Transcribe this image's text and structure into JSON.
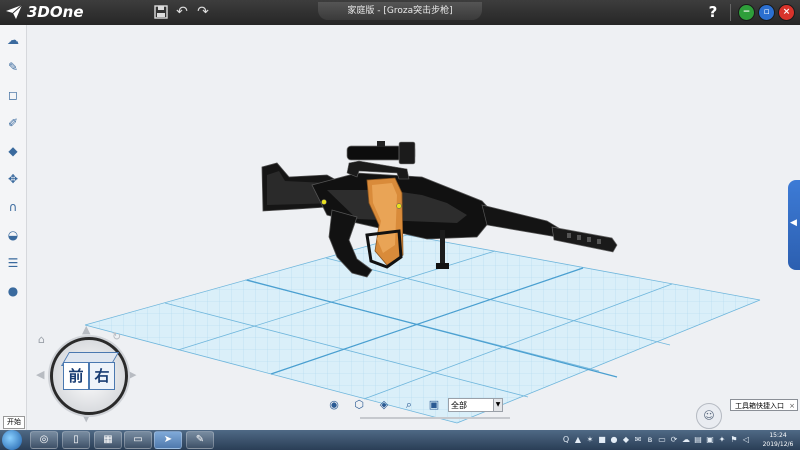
{
  "app": {
    "logo_text": "3DOne",
    "document_title": "家庭版 - [Groza突击步枪]",
    "help_label": "?",
    "colors": {
      "titlebar": "#2f2f2f",
      "accent": "#2c5fb0",
      "grid": "#8fc9e6",
      "model_body": "#111111",
      "model_grip": "#d98b3a"
    }
  },
  "titlebar_icons": [
    "save-icon",
    "undo-icon",
    "redo-icon"
  ],
  "window_controls": [
    {
      "name": "minimize-button",
      "symbol": "−",
      "color": "#2e9e3a"
    },
    {
      "name": "restore-button",
      "symbol": "▫",
      "color": "#2b6fd0"
    },
    {
      "name": "close-button",
      "symbol": "×",
      "color": "#d8332b"
    }
  ],
  "sidebar": {
    "items": [
      {
        "name": "sketch-tool-icon",
        "symbol": "☁"
      },
      {
        "name": "pen-tool-icon",
        "symbol": "✎"
      },
      {
        "name": "frame-tool-icon",
        "symbol": "◻"
      },
      {
        "name": "edit-tool-icon",
        "symbol": "✐"
      },
      {
        "name": "solid-tool-icon",
        "symbol": "◆"
      },
      {
        "name": "transform-tool-icon",
        "symbol": "✥"
      },
      {
        "name": "magnet-tool-icon",
        "symbol": "∩"
      },
      {
        "name": "combine-tool-icon",
        "symbol": "◒"
      },
      {
        "name": "layer-tool-icon",
        "symbol": "☰"
      },
      {
        "name": "material-tool-icon",
        "symbol": "●"
      }
    ]
  },
  "viewcube": {
    "front": "前",
    "right": "右"
  },
  "start_label": "开始",
  "view_toolbar": {
    "icons": [
      "view-eye-icon",
      "view-home-icon",
      "view-style-icon",
      "zoom-icon",
      "render-icon"
    ],
    "filter_value": "全部"
  },
  "tooltip": {
    "text": "工具箱快捷入口",
    "close": "×"
  },
  "taskbar": {
    "apps": [
      "chrome-icon",
      "document-icon",
      "calculator-icon",
      "folder-icon",
      "3done-app-icon",
      "paint-icon"
    ],
    "time": "15:24",
    "date": "2019/12/6"
  }
}
